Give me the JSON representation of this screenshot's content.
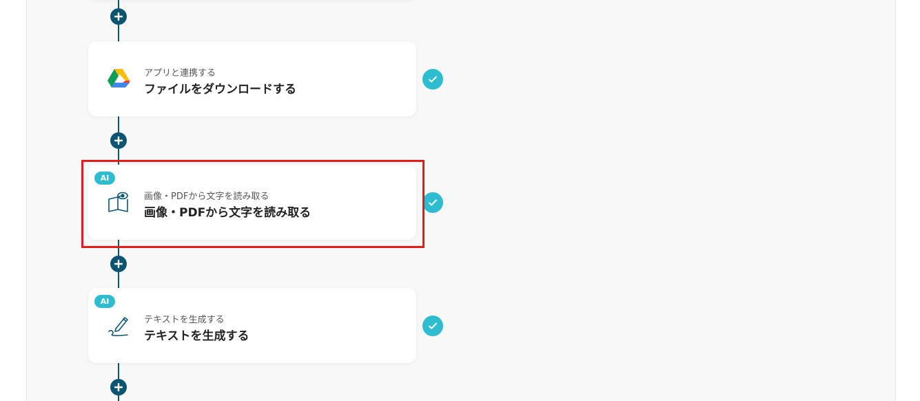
{
  "flow": {
    "steps": [
      {
        "subtitle": "アプリと連携する",
        "title": "ファイルをダウンロードする",
        "icon": "google-drive-icon",
        "ai": false,
        "status": "completed"
      },
      {
        "badge": "AI",
        "subtitle": "画像・PDFから文字を読み取る",
        "title": "画像・PDFから文字を読み取る",
        "icon": "book-eye-icon",
        "ai": true,
        "status": "completed",
        "highlighted": true
      },
      {
        "badge": "AI",
        "subtitle": "テキストを生成する",
        "title": "テキストを生成する",
        "icon": "pen-write-icon",
        "ai": true,
        "status": "completed"
      }
    ],
    "colors": {
      "connector": "#0b5572",
      "check": "#2dbcd0",
      "ai_badge": "#2dbcd0",
      "highlight": "#e31b1b",
      "canvas": "#f8f8f8"
    }
  }
}
